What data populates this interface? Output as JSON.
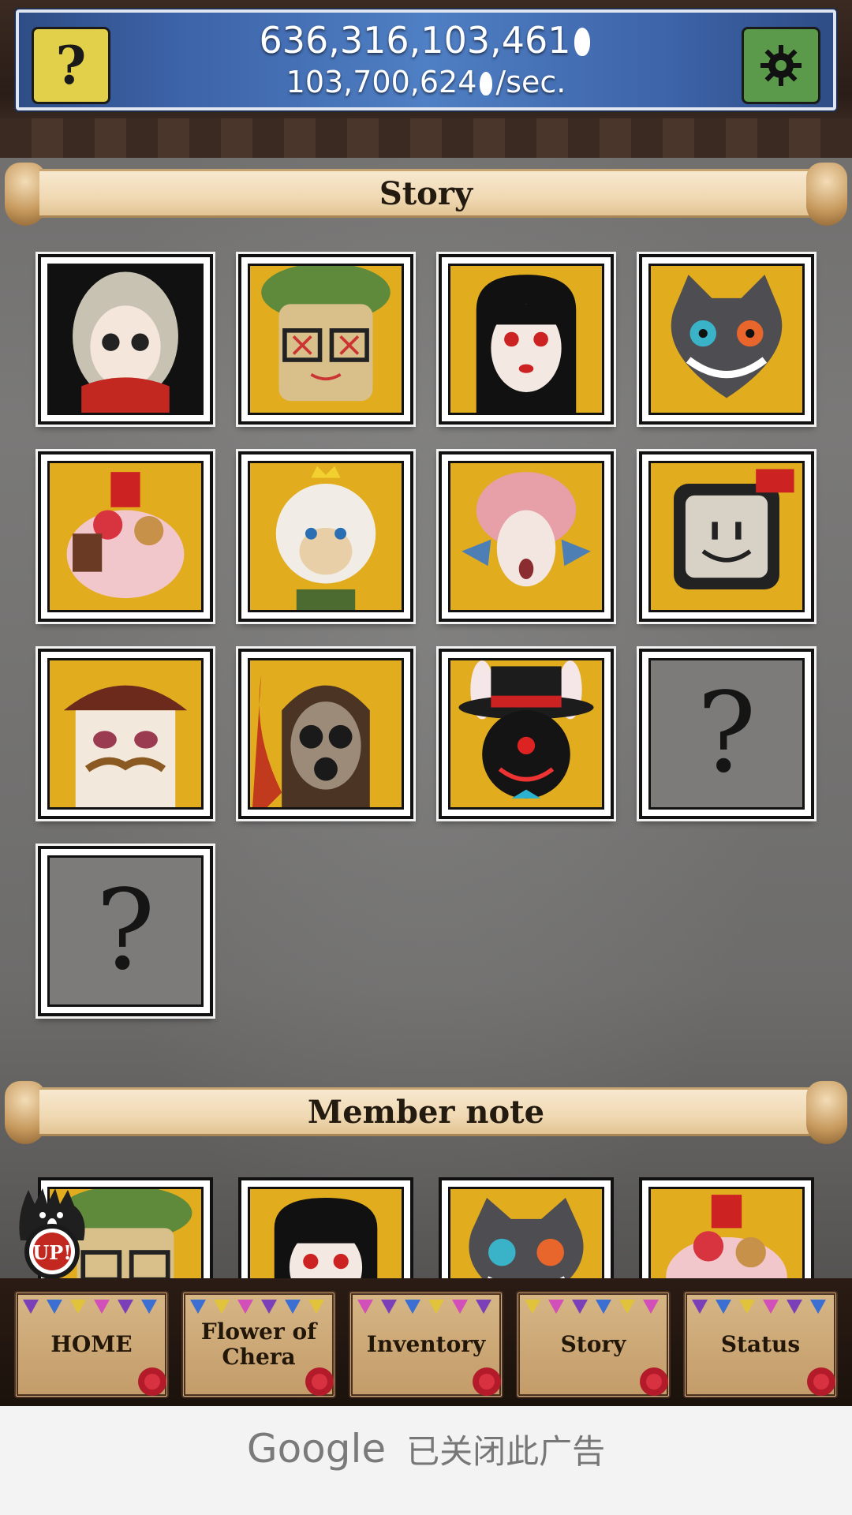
{
  "header": {
    "total_coins": "636,316,103,461",
    "rate": "103,700,624",
    "rate_suffix": "/sec.",
    "help_label": "?"
  },
  "sections": {
    "story_title": "Story",
    "member_note_title": "Member note"
  },
  "story_grid": {
    "locked_label": "?",
    "characters": [
      "girl-scarf-portrait",
      "glasses-cap-boy-portrait",
      "black-hair-girl-portrait",
      "cheshire-cat-portrait",
      "parfait-dessert-portrait",
      "alpaca-king-portrait",
      "bat-wing-girl-portrait",
      "tv-head-portrait",
      "nutcracker-portrait",
      "gas-mask-portrait",
      "top-hat-rabbit-portrait",
      "locked",
      "locked"
    ]
  },
  "member_note": {
    "badge_label": "UP!",
    "characters": [
      "glasses-cap-boy-portrait",
      "black-hair-girl-portrait",
      "cheshire-cat-portrait",
      "parfait-dessert-portrait"
    ]
  },
  "nav": {
    "items": [
      "HOME",
      "Flower of\nChera",
      "Inventory",
      "Story",
      "Status"
    ]
  },
  "ad": {
    "brand": "Google",
    "message": "已关闭此广告"
  },
  "colors": {
    "header_blue": "#3d63a8",
    "help_yellow": "#e3d04a",
    "settings_green": "#5a9a4a",
    "portrait_gold": "#e1ac1e",
    "locked_gray": "#7c7b7a"
  }
}
